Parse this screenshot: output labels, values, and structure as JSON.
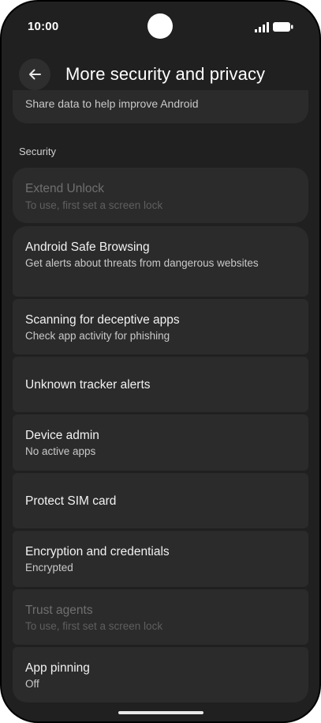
{
  "status_bar": {
    "time": "10:00"
  },
  "header": {
    "title": "More security and privacy"
  },
  "partial_item": {
    "subtitle": "Share data to help improve Android"
  },
  "section": {
    "label": "Security"
  },
  "items": [
    {
      "title": "Extend Unlock",
      "subtitle": "To use, first set a screen lock",
      "disabled": true
    },
    {
      "title": "Android Safe Browsing",
      "subtitle": "Get alerts about threats from dangerous websites"
    },
    {
      "title": "Scanning for deceptive apps",
      "subtitle": "Check app activity for phishing"
    },
    {
      "title": "Unknown tracker alerts",
      "subtitle": ""
    },
    {
      "title": "Device admin",
      "subtitle": "No active apps"
    },
    {
      "title": "Protect SIM card",
      "subtitle": ""
    },
    {
      "title": "Encryption and credentials",
      "subtitle": "Encrypted"
    },
    {
      "title": "Trust agents",
      "subtitle": "To use, first set a screen lock",
      "disabled": true
    },
    {
      "title": "App pinning",
      "subtitle": "Off"
    }
  ]
}
